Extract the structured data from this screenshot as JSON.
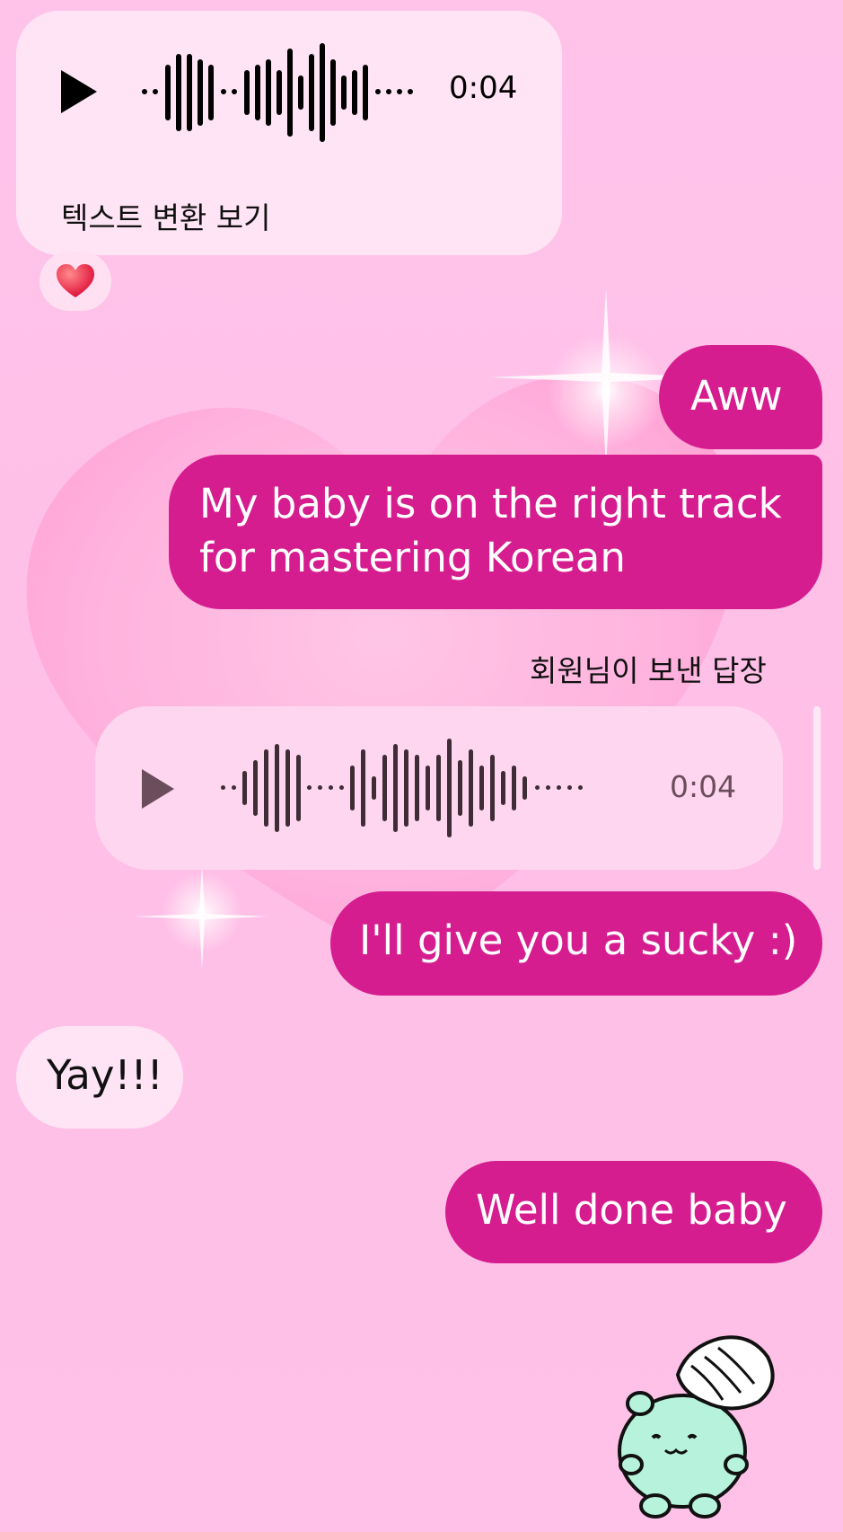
{
  "messages": {
    "voice1": {
      "duration": "0:04",
      "transcribe_label": "텍스트 변환 보기",
      "reaction_icon": "heart-emoji"
    },
    "out1": {
      "text": "Aww"
    },
    "out2": {
      "text_line1": "My baby is on the right track",
      "text_line2": "for mastering Korean"
    },
    "reply_label": "회원님이 보낸 답장",
    "voice2": {
      "duration": "0:04"
    },
    "out3": {
      "text": "I'll give you a sucky :)"
    },
    "in1": {
      "text": "Yay!!!"
    },
    "out4": {
      "text": "Well done baby"
    },
    "sticker": {
      "icon": "hamster-headpat-sticker"
    }
  },
  "colors": {
    "background": "#ffbfe7",
    "incoming_bubble": "#ffe4f5",
    "outgoing_bubble": "#d61d8f",
    "reply_bubble": "#ffd6ef"
  }
}
